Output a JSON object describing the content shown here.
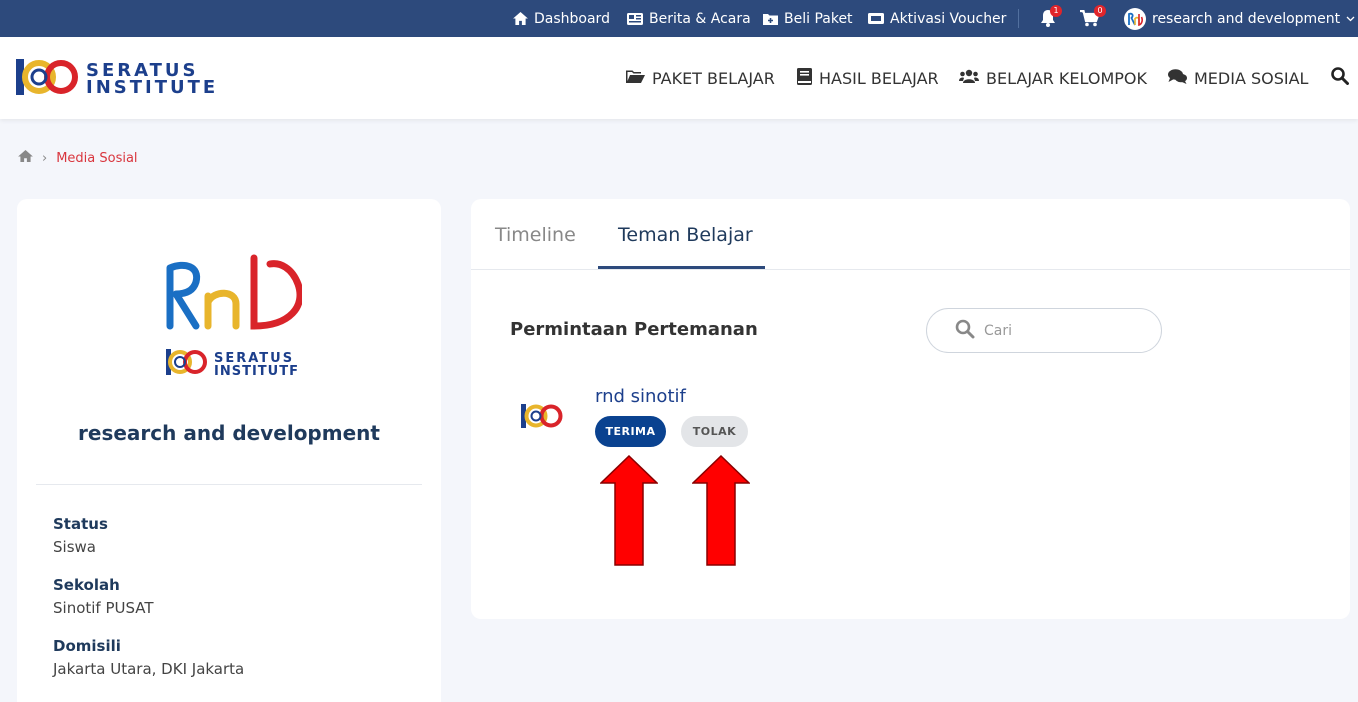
{
  "topbar": {
    "links": [
      {
        "label": "Dashboard",
        "icon": "home-icon"
      },
      {
        "label": "Berita & Acara",
        "icon": "newspaper-icon"
      },
      {
        "label": "Beli Paket",
        "icon": "folder-plus-icon"
      },
      {
        "label": "Aktivasi Voucher",
        "icon": "ticket-icon"
      }
    ],
    "notification_count": "1",
    "cart_count": "0",
    "user_name": "research and development"
  },
  "brand": {
    "line1": "SERATUS",
    "line2": "INSTITUTE"
  },
  "nav": {
    "items": [
      {
        "label": "PAKET BELAJAR",
        "icon": "folder-open-icon"
      },
      {
        "label": "HASIL BELAJAR",
        "icon": "book-icon"
      },
      {
        "label": "BELAJAR KELOMPOK",
        "icon": "users-icon"
      },
      {
        "label": "MEDIA SOSIAL",
        "icon": "comments-icon"
      }
    ]
  },
  "breadcrumb": {
    "current": "Media Sosial"
  },
  "profile": {
    "school_logo_line1": "SERATUS",
    "school_logo_line2": "INSTITUTF",
    "name": "research and development",
    "fields": [
      {
        "label": "Status",
        "value": "Siswa"
      },
      {
        "label": "Sekolah",
        "value": "Sinotif PUSAT"
      },
      {
        "label": "Domisili",
        "value": "Jakarta Utara, DKI Jakarta"
      }
    ]
  },
  "main": {
    "tabs": [
      {
        "label": "Timeline",
        "active": false
      },
      {
        "label": "Teman Belajar",
        "active": true
      }
    ],
    "section_title": "Permintaan Pertemanan",
    "search_placeholder": "Cari",
    "requests": [
      {
        "name": "rnd sinotif",
        "accept_label": "TERIMA",
        "reject_label": "TOLAK"
      }
    ]
  },
  "colors": {
    "topbar_bg": "#2d4a7c",
    "accent_blue": "#0a4290",
    "breadcrumb_active": "#d9363e",
    "annotation_arrow": "#ff0000"
  }
}
